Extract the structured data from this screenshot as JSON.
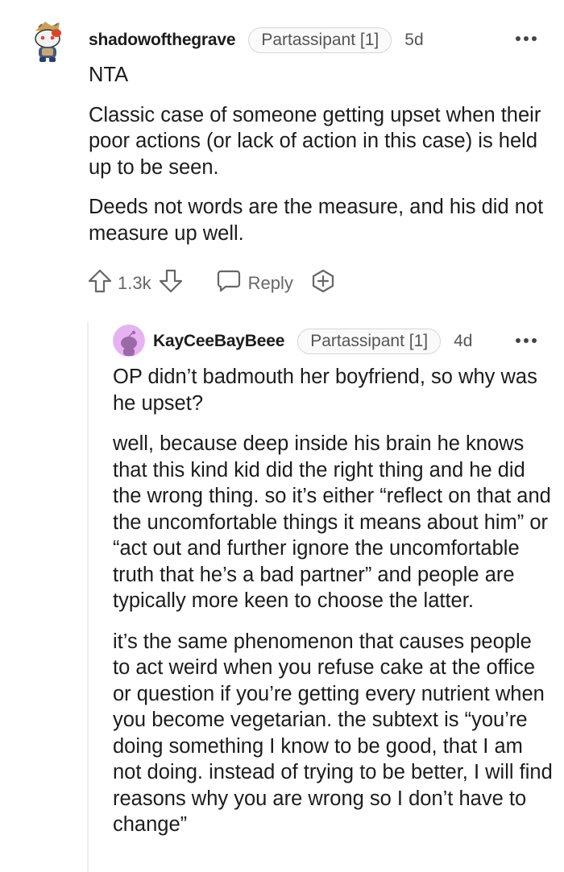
{
  "comment": {
    "username": "shadowofthegrave",
    "flair": "Partassipant [1]",
    "age": "5d",
    "paragraphs": [
      "NTA",
      "Classic case of someone getting upset when their poor actions (or lack of action in this case) is held up to be seen.",
      "Deeds not words are the measure, and his did not measure up well."
    ],
    "votes": "1.3k",
    "reply_label": "Reply",
    "icons": {
      "avatar": "snoo-avatar-icon",
      "upvote": "upvote-arrow-icon",
      "downvote": "downvote-arrow-icon",
      "reply": "speech-bubble-icon",
      "award": "award-plus-icon",
      "more": "more-options-icon"
    }
  },
  "reply": {
    "username": "KayCeeBayBeee",
    "flair": "Partassipant [1]",
    "age": "4d",
    "paragraphs": [
      "OP didn’t badmouth her boyfriend, so why was he upset?",
      "well, because deep inside his brain he knows that this kind kid did the right thing and he did the wrong thing. so it’s either “reflect on that and the uncomfortable things it means about him” or “act out and further ignore the uncomfortable truth that he’s a bad partner” and people are typically more keen to choose the latter.",
      "it’s the same phenomenon that causes people to act weird when you refuse cake at the office or question if you’re getting every nutrient when you become vegetarian. the subtext is “you’re doing something I know to be good, that I am not doing. instead of trying to be better, I will find reasons why you are wrong so I don’t have to change”"
    ],
    "icons": {
      "avatar": "default-snoo-avatar-icon",
      "more": "more-options-icon"
    }
  },
  "colors": {
    "text": "#1c1c1c",
    "muted": "#555555",
    "flair_border": "#d6d6d6",
    "avatar_bg": "#e6b3f0"
  }
}
